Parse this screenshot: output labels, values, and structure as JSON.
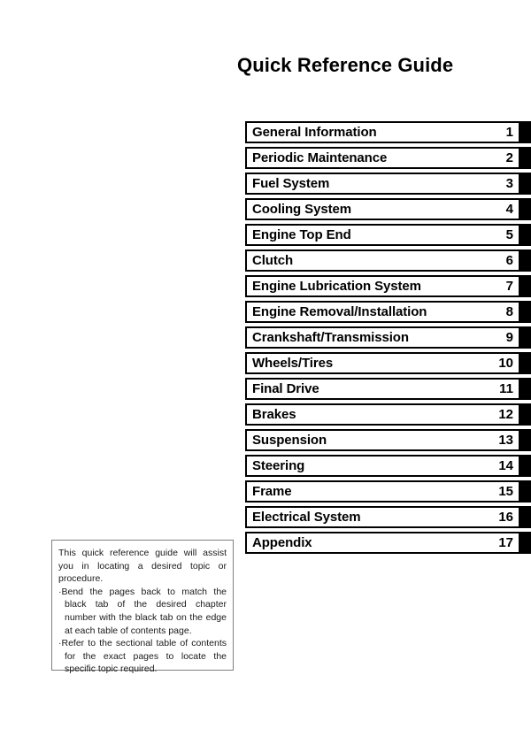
{
  "document": {
    "title": "Quick Reference Guide"
  },
  "chapter_index": {
    "rows": [
      {
        "label": "General Information",
        "number": "1"
      },
      {
        "label": "Periodic Maintenance",
        "number": "2"
      },
      {
        "label": "Fuel System",
        "number": "3"
      },
      {
        "label": "Cooling System",
        "number": "4"
      },
      {
        "label": "Engine Top End",
        "number": "5"
      },
      {
        "label": "Clutch",
        "number": "6"
      },
      {
        "label": "Engine Lubrication System",
        "number": "7"
      },
      {
        "label": "Engine Removal/Installation",
        "number": "8"
      },
      {
        "label": "Crankshaft/Transmission",
        "number": "9"
      },
      {
        "label": "Wheels/Tires",
        "number": "10"
      },
      {
        "label": "Final Drive",
        "number": "11"
      },
      {
        "label": "Brakes",
        "number": "12"
      },
      {
        "label": "Suspension",
        "number": "13"
      },
      {
        "label": "Steering",
        "number": "14"
      },
      {
        "label": "Frame",
        "number": "15"
      },
      {
        "label": "Electrical System",
        "number": "16"
      },
      {
        "label": "Appendix",
        "number": "17"
      }
    ]
  },
  "note": {
    "paragraph_1": "This quick reference guide will assist you in locating a desired topic or procedure.",
    "bullet_1": "Bend the pages back to match the black tab of the desired chapter number with the black tab on the edge at each table of contents page.",
    "bullet_2": "Refer to the sectional table of contents for the exact pages to locate the specific topic required.",
    "bullet_glyph": "·"
  },
  "colors": {
    "page_background": "#ffffff",
    "ink": "#000000",
    "tab_black": "#000000",
    "note_border": "#808080",
    "note_text": "#1a1a1a"
  }
}
